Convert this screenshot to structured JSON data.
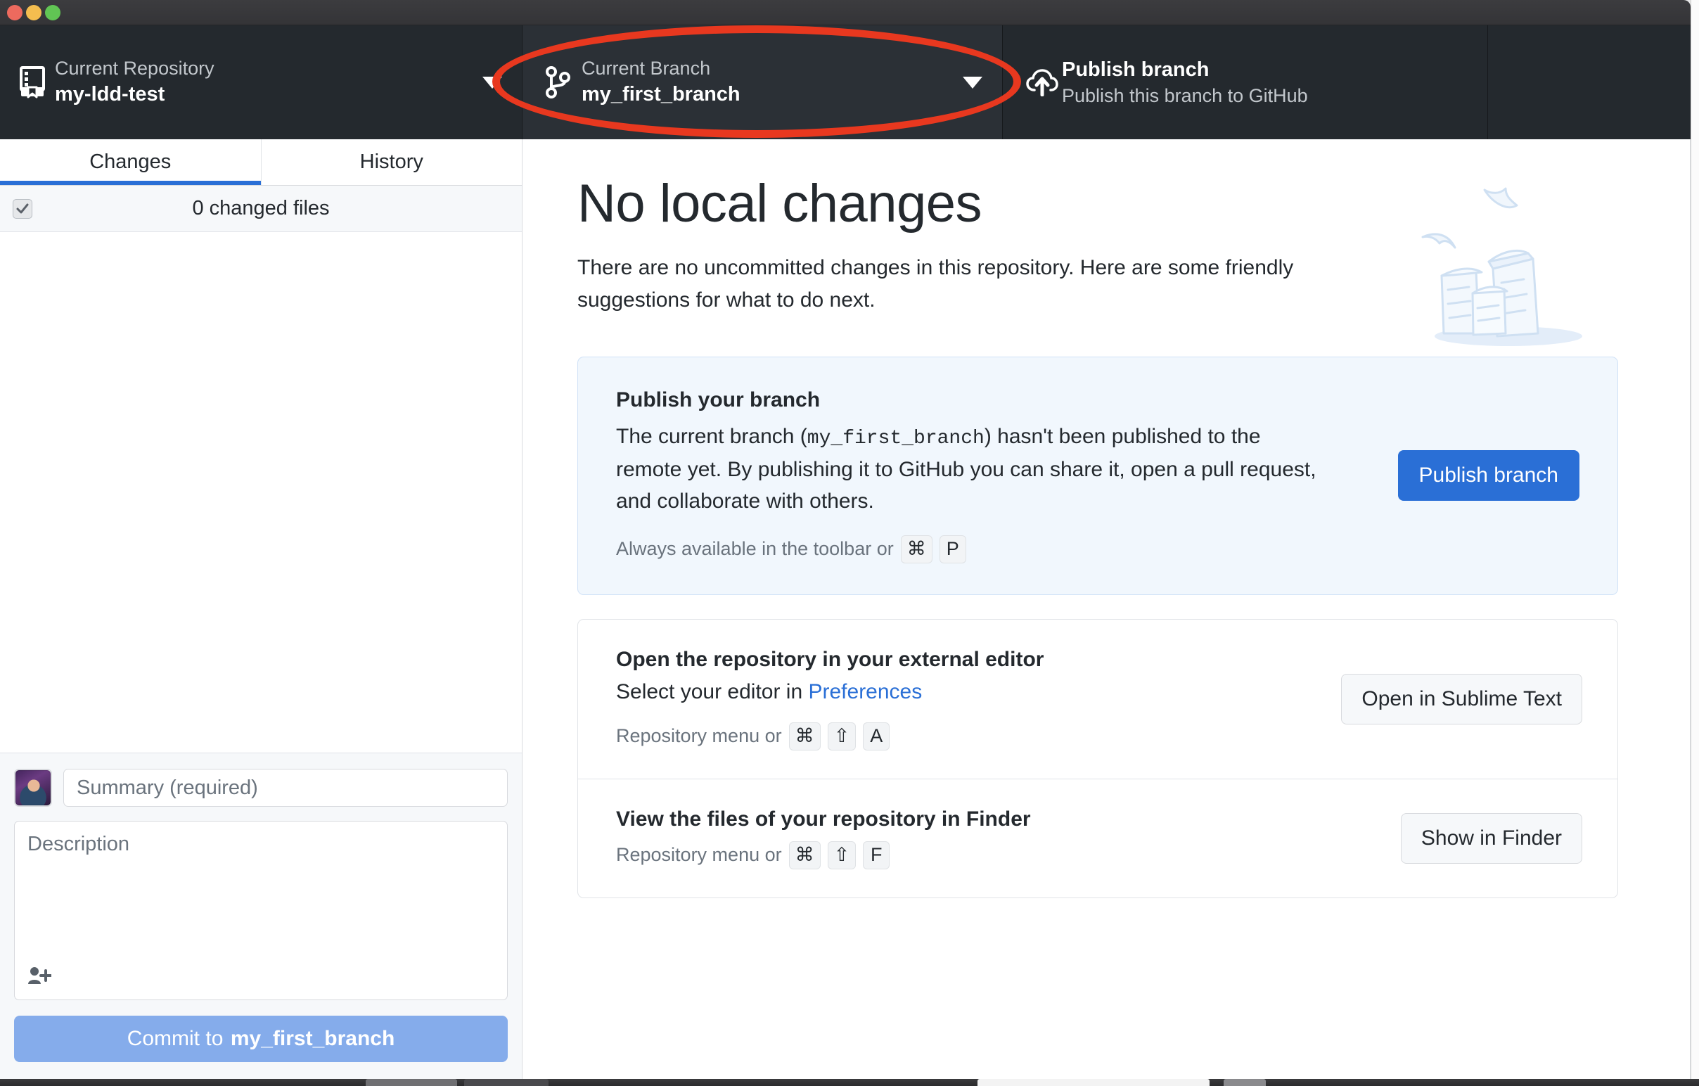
{
  "window": {
    "traffic_lights": [
      "close",
      "minimize",
      "maximize"
    ]
  },
  "toolbar": {
    "repository": {
      "label": "Current Repository",
      "value": "my-ldd-test",
      "icon": "repository-icon"
    },
    "branch": {
      "label": "Current Branch",
      "value": "my_first_branch",
      "icon": "branch-icon"
    },
    "publish": {
      "title": "Publish branch",
      "subtitle": "Publish this branch to GitHub",
      "icon": "cloud-upload-icon"
    }
  },
  "annotation": {
    "shape": "ellipse",
    "color": "#e8381f",
    "target": "current-branch-dropdown"
  },
  "sidebar": {
    "tabs": [
      {
        "label": "Changes",
        "active": true
      },
      {
        "label": "History",
        "active": false
      }
    ],
    "changed_files_count_text": "0 changed files",
    "select_all_checked": true,
    "commit": {
      "summary_placeholder": "Summary (required)",
      "summary_value": "",
      "description_placeholder": "Description",
      "description_value": "",
      "coauthor_icon": "add-coauthor-icon",
      "button_prefix": "Commit to ",
      "button_branch": "my_first_branch"
    }
  },
  "main": {
    "title": "No local changes",
    "subtitle": "There are no uncommitted changes in this repository. Here are some friendly suggestions for what to do next.",
    "illustration": "paper-stack-illustration",
    "publish_card": {
      "title": "Publish your branch",
      "text_before": "The current branch (",
      "branch_name": "my_first_branch",
      "text_after": ") hasn't been published to the remote yet. By publishing it to GitHub you can share it, open a pull request, and collaborate with others.",
      "hint_prefix": "Always available in the toolbar or",
      "hint_keys": [
        "⌘",
        "P"
      ],
      "button_label": "Publish branch"
    },
    "suggestions": [
      {
        "title": "Open the repository in your external editor",
        "text_before": "Select your editor in ",
        "link_text": "Preferences",
        "hint_prefix": "Repository menu or",
        "hint_keys": [
          "⌘",
          "⇧",
          "A"
        ],
        "button_label": "Open in Sublime Text"
      },
      {
        "title": "View the files of your repository in Finder",
        "text_before": "",
        "link_text": "",
        "hint_prefix": "Repository menu or",
        "hint_keys": [
          "⌘",
          "⇧",
          "F"
        ],
        "button_label": "Show in Finder"
      }
    ]
  },
  "colors": {
    "toolbar_bg": "#24292e",
    "accent_blue": "#2a6fd6",
    "annotation_red": "#e8381f",
    "card_bg": "#f1f7fd",
    "commit_button": "#85aceb"
  }
}
